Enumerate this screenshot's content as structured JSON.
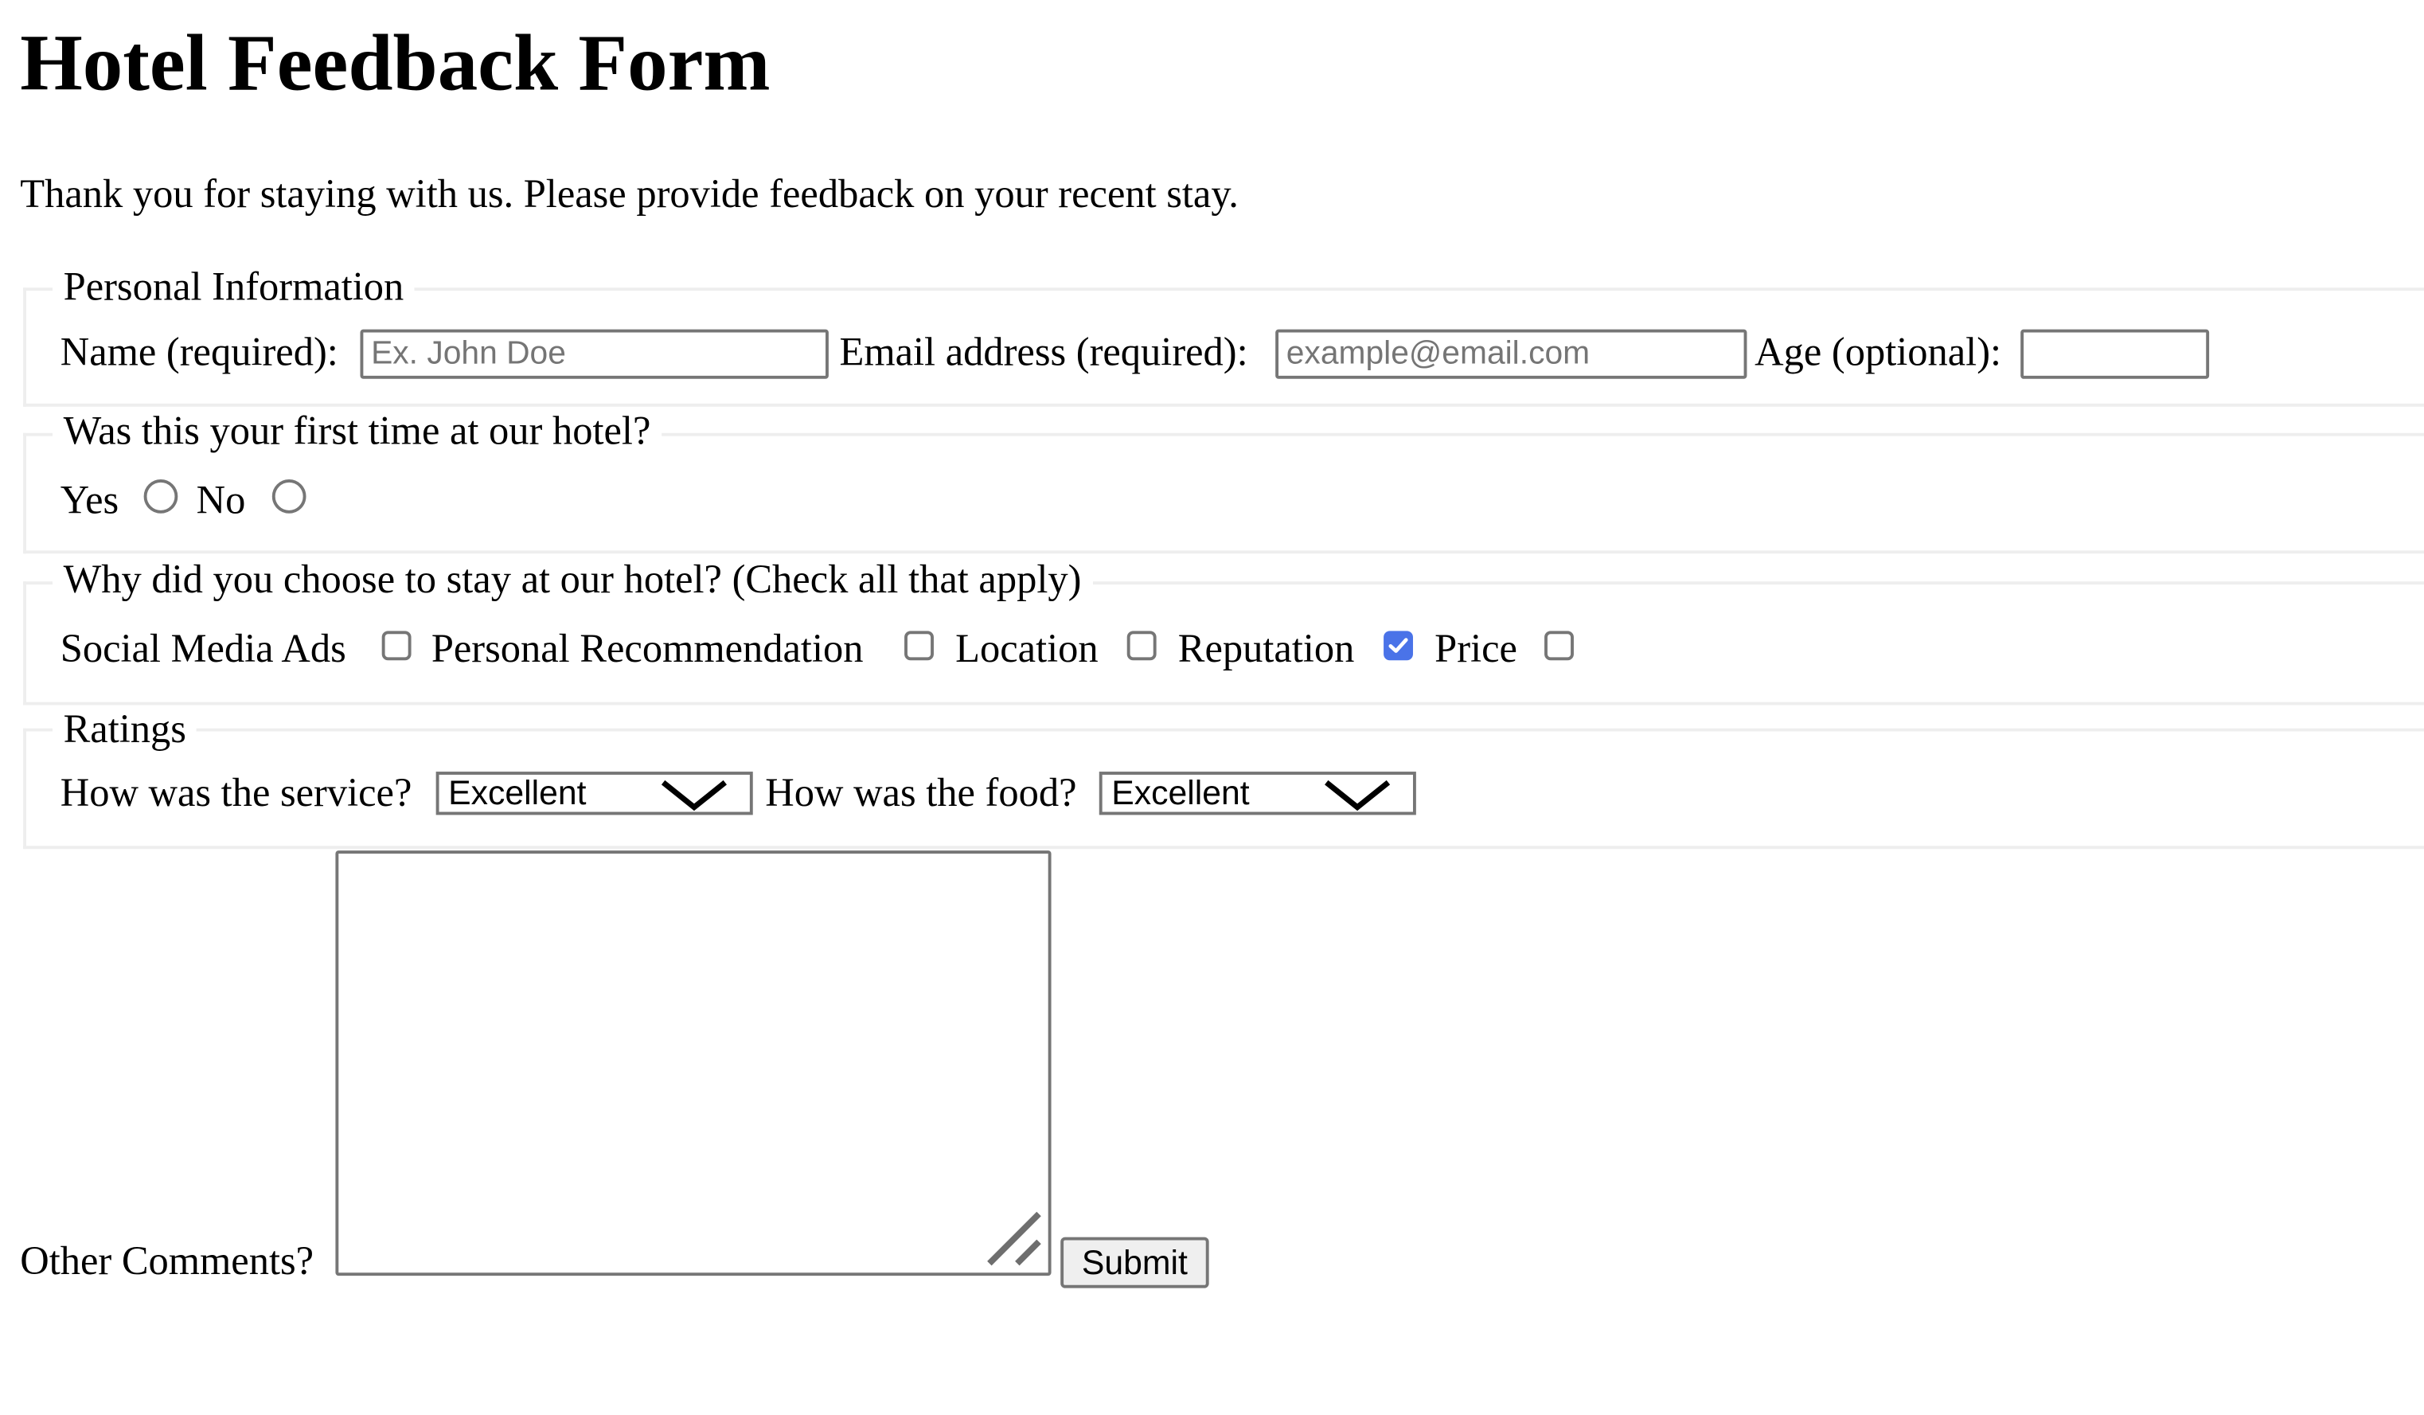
{
  "page": {
    "title": "Hotel Feedback Form",
    "intro": "Thank you for staying with us. Please provide feedback on your recent stay."
  },
  "personal": {
    "legend": "Personal Information",
    "name_label": "Name (required):",
    "name_placeholder": "Ex. John Doe",
    "name_value": "",
    "email_label": "Email address (required):",
    "email_placeholder": "example@email.com",
    "email_value": "",
    "age_label": "Age (optional):",
    "age_value": ""
  },
  "first_time": {
    "legend": "Was this your first time at our hotel?",
    "options": [
      {
        "label": "Yes",
        "checked": false
      },
      {
        "label": "No",
        "checked": false
      }
    ]
  },
  "reasons": {
    "legend": "Why did you choose to stay at our hotel? (Check all that apply)",
    "options": [
      {
        "label": "Social Media Ads",
        "checked": false
      },
      {
        "label": "Personal Recommendation",
        "checked": false
      },
      {
        "label": "Location",
        "checked": false
      },
      {
        "label": "Reputation",
        "checked": true
      },
      {
        "label": "Price",
        "checked": false
      }
    ]
  },
  "ratings": {
    "legend": "Ratings",
    "service_label": "How was the service?",
    "service_value": "Excellent",
    "food_label": "How was the food?",
    "food_value": "Excellent"
  },
  "comments": {
    "label": "Other Comments?",
    "value": ""
  },
  "submit_label": "Submit",
  "colors": {
    "checkbox_checked": "#4a73e8",
    "fieldset_border": "#eeeeee",
    "control_border": "#767676",
    "button_bg": "#efefef"
  }
}
